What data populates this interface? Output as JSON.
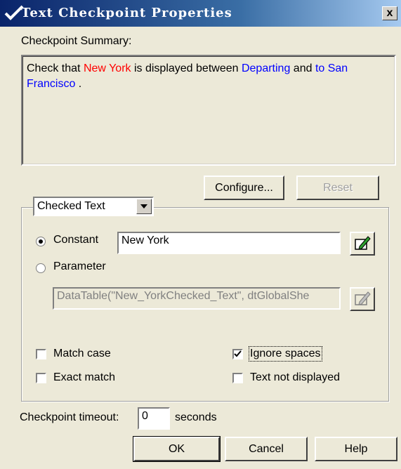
{
  "dialog": {
    "title": "Text Checkpoint Properties",
    "close_glyph": "x"
  },
  "summary": {
    "label": "Checkpoint Summary:",
    "part1": "Check that ",
    "checked_value": "New York",
    "part2": "  is  displayed between ",
    "departing": "Departing",
    "part3": " and ",
    "to_sf": "to San Francisco",
    "part4": " ."
  },
  "buttons": {
    "configure": "Configure...",
    "reset": "Reset",
    "ok": "OK",
    "cancel": "Cancel",
    "help": "Help"
  },
  "group": {
    "combo_value": "Checked Text",
    "constant_label": "Constant",
    "constant_value": "New York",
    "parameter_label": "Parameter",
    "parameter_value": "DataTable(\"New_YorkChecked_Text\", dtGlobalShe",
    "selected_option": "Constant"
  },
  "options": {
    "match_case": {
      "label": "Match case",
      "checked": false
    },
    "exact_match": {
      "label": "Exact match",
      "checked": false
    },
    "ignore_spaces": {
      "label": "Ignore spaces",
      "checked": true
    },
    "text_not_displayed": {
      "label": "Text not displayed",
      "checked": false
    }
  },
  "timeout": {
    "label": "Checkpoint timeout:",
    "value": "0",
    "unit": "seconds"
  },
  "icons": {
    "title_icon": "checkmark-icon",
    "edit_icon": "edit-pencil-icon",
    "dropdown_icon": "chevron-down-icon"
  },
  "colors": {
    "title_bar": "#0a246a",
    "highlight_red": "#ff0000",
    "highlight_blue": "#0000ff",
    "face": "#ece9d8"
  }
}
